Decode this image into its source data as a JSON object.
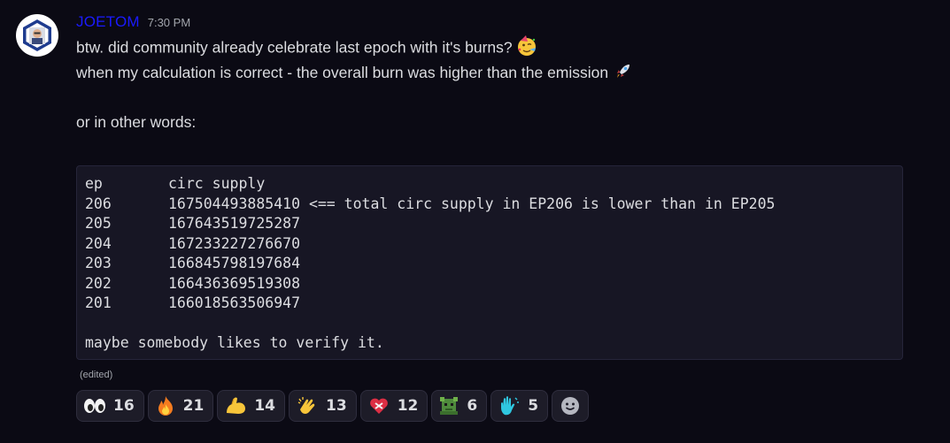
{
  "message": {
    "username": "JOETOM",
    "timestamp": "7:30 PM",
    "line1": "btw. did community already celebrate last epoch with it's burns?",
    "line2": "when my calculation is correct - the overall burn was higher than the emission",
    "line3": "or in other words:",
    "edited_label": "(edited)"
  },
  "code_block": {
    "header": {
      "ep": "ep",
      "value": "circ supply"
    },
    "rows": [
      {
        "ep": "206",
        "value": "167504493885410 <== total circ supply in EP206 is lower than in EP205"
      },
      {
        "ep": "205",
        "value": "167643519725287"
      },
      {
        "ep": "204",
        "value": "167233227276670"
      },
      {
        "ep": "203",
        "value": "166845798197684"
      },
      {
        "ep": "202",
        "value": "166436369519308"
      },
      {
        "ep": "201",
        "value": "166018563506947"
      }
    ],
    "footer": "maybe somebody likes to verify it."
  },
  "inline_emojis": [
    "partying-face-icon",
    "rocket-icon"
  ],
  "reactions": [
    {
      "icon": "eyes-icon",
      "count": "16"
    },
    {
      "icon": "fire-icon",
      "count": "21"
    },
    {
      "icon": "flexed-biceps-icon",
      "count": "14"
    },
    {
      "icon": "clapping-hands-icon",
      "count": "13"
    },
    {
      "icon": "mending-heart-icon",
      "count": "12"
    },
    {
      "icon": "pixel-creature-icon",
      "count": "6"
    },
    {
      "icon": "waving-hand-icon",
      "count": "5"
    }
  ],
  "colors": {
    "background": "#0b0a14",
    "username": "#1a1aff",
    "code_background": "#171624",
    "reaction_background": "#1d1c28"
  }
}
